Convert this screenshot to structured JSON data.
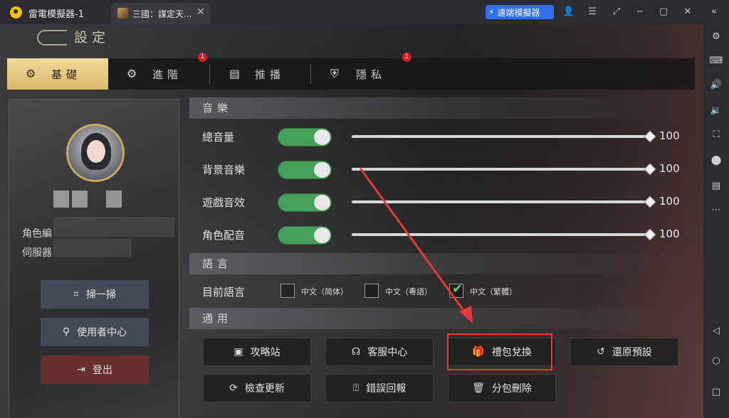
{
  "titlebar": {
    "app_title": "雷電模擬器-1",
    "tab_label": "三國：謀定天...",
    "tab_close": "✕",
    "remote_label": "遠端模擬器",
    "controls": [
      "👤",
      "☰",
      "⤢",
      "−",
      "▢",
      "✕",
      "«"
    ]
  },
  "sidebar": {
    "icons": [
      "⚙",
      "⌨",
      "🔊",
      "🔉",
      "⛶",
      "⬤",
      "▤",
      "⋯",
      "◁",
      "○",
      "□"
    ]
  },
  "header": {
    "title": "設定"
  },
  "tabs": [
    {
      "label": "基礎",
      "icon": "gear-icon",
      "glyph": "⚙",
      "active": true,
      "badge": ""
    },
    {
      "label": "進階",
      "icon": "gear-advanced-icon",
      "glyph": "⚙",
      "active": false,
      "badge": "1"
    },
    {
      "label": "推播",
      "icon": "chat-icon",
      "glyph": "▤",
      "active": false,
      "badge": ""
    },
    {
      "label": "隱私",
      "icon": "shield-icon",
      "glyph": "⛨",
      "active": false,
      "badge": "1"
    }
  ],
  "profile": {
    "role_label": "角色編",
    "server_label": "伺服器",
    "buttons": {
      "scan": {
        "label": "掃一掃",
        "glyph": "⌗"
      },
      "user_center": {
        "label": "使用者中心",
        "glyph": "⚲"
      },
      "logout": {
        "label": "登出",
        "glyph": "⇥"
      }
    }
  },
  "audio": {
    "section_title": "音樂",
    "rows": [
      {
        "label": "總音量",
        "value": "100",
        "on": true,
        "level": 1.0
      },
      {
        "label": "背景音樂",
        "value": "100",
        "on": true,
        "level": 1.0
      },
      {
        "label": "遊戲音效",
        "value": "100",
        "on": true,
        "level": 1.0
      },
      {
        "label": "角色配音",
        "value": "100",
        "on": true,
        "level": 1.0
      }
    ]
  },
  "language": {
    "section_title": "語言",
    "current_label": "目前語言",
    "options": [
      {
        "label": "中文（简体）",
        "checked": false
      },
      {
        "label": "中文（粵語）",
        "checked": false
      },
      {
        "label": "中文（繁體）",
        "checked": true
      }
    ]
  },
  "general": {
    "section_title": "通用",
    "buttons": [
      {
        "label": "攻略站",
        "glyph": "▣",
        "icon": "guide-icon"
      },
      {
        "label": "客服中心",
        "glyph": "☊",
        "icon": "headset-icon"
      },
      {
        "label": "禮包兌換",
        "glyph": "🎁",
        "icon": "gift-icon"
      },
      {
        "label": "還原預設",
        "glyph": "↺",
        "icon": "reset-icon"
      },
      {
        "label": "檢查更新",
        "glyph": "⟳",
        "icon": "refresh-icon"
      },
      {
        "label": "錯誤回報",
        "glyph": "⍰",
        "icon": "report-icon"
      },
      {
        "label": "分包刪除",
        "glyph": "🗑",
        "icon": "trash-icon"
      }
    ]
  },
  "colors": {
    "toggle_on": "#46a05a",
    "active_tab": "#e7c97f",
    "annotation": "#e53935"
  }
}
